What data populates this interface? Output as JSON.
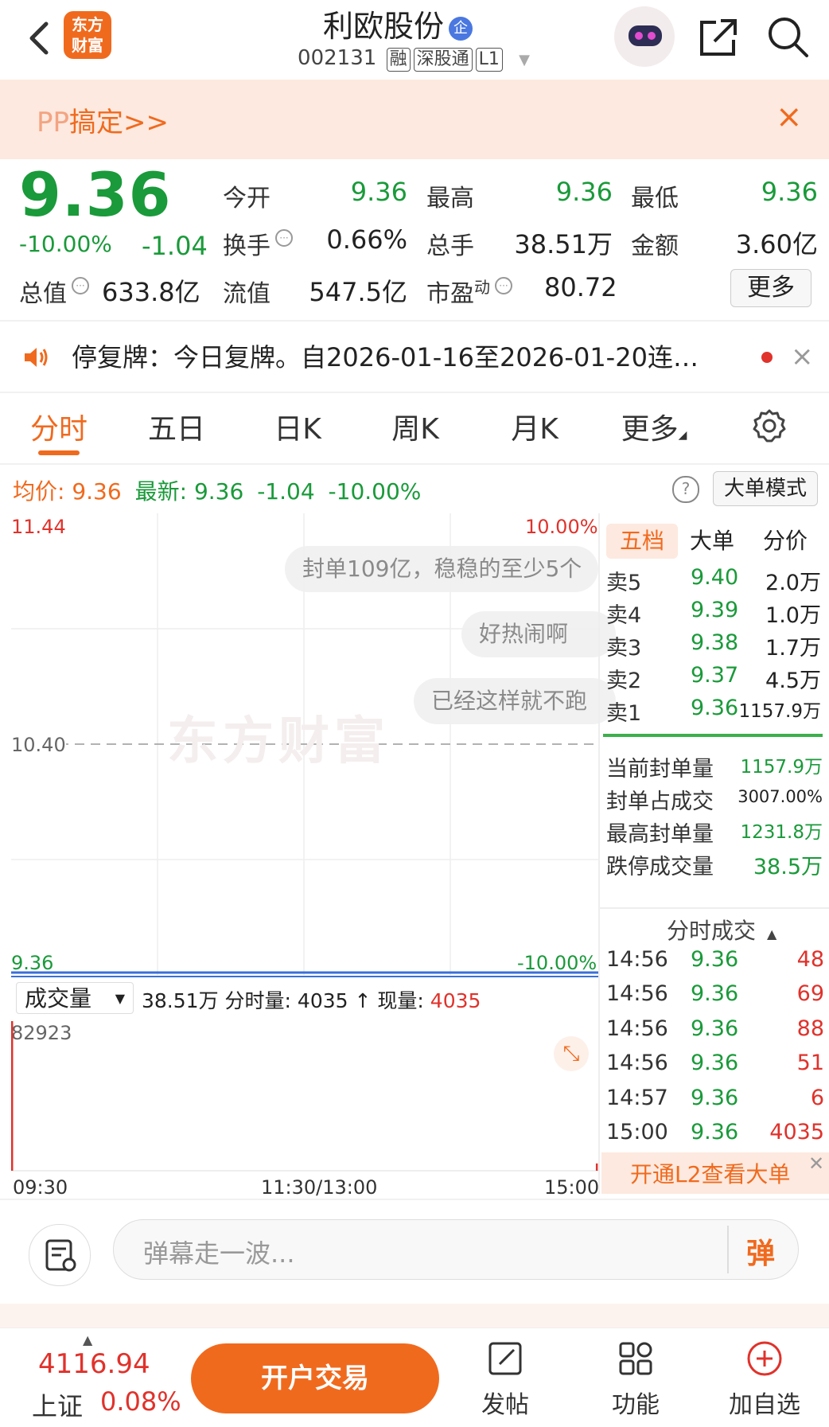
{
  "header": {
    "logo_text_line1": "东方",
    "logo_text_line2": "财富",
    "stock_name": "利欧股份",
    "qi_badge": "企",
    "stock_code": "002131",
    "tags": [
      "融",
      "深股通",
      "L1"
    ]
  },
  "promo": {
    "text_pp": "PP",
    "text_main": "搞定>>",
    "close": "×"
  },
  "quote": {
    "price": "9.36",
    "pct": "-10.00%",
    "change": "-1.04",
    "fields": [
      {
        "label": "今开",
        "value": "9.36",
        "color": "green"
      },
      {
        "label": "最高",
        "value": "9.36",
        "color": "green"
      },
      {
        "label": "最低",
        "value": "9.36",
        "color": "green"
      },
      {
        "label": "换手",
        "value": "0.66%",
        "color": "black"
      },
      {
        "label": "总手",
        "value": "38.51万",
        "color": "black"
      },
      {
        "label": "金额",
        "value": "3.60亿",
        "color": "black"
      },
      {
        "label": "流值",
        "value": "547.5亿",
        "color": "black"
      }
    ],
    "total_value_label": "总值",
    "total_value": "633.8亿",
    "pe_label": "市盈",
    "pe_sup": "动",
    "pe_value": "80.72",
    "more_label": "更多"
  },
  "notice": {
    "text": "停复牌：今日复牌。自2026-01-16至2026-01-20连…",
    "close": "×"
  },
  "tabs": [
    "分时",
    "五日",
    "日K",
    "周K",
    "月K",
    "更多"
  ],
  "info_line": {
    "avg_label": "均价:",
    "avg_value": "9.36",
    "latest_label": "最新:",
    "latest_value": "9.36",
    "change": "-1.04",
    "pct": "-10.00%",
    "help": "?",
    "mode_button": "大单模式"
  },
  "chart": {
    "y_top": "11.44",
    "y_top_pct": "10.00%",
    "y_mid": "10.40",
    "y_bottom": "9.36",
    "y_bottom_pct": "-10.00%",
    "danmu": [
      "封单109亿，稳稳的至少5个",
      "好热闹啊",
      "已经这样就不跑"
    ],
    "watermark": "东方财富",
    "x_labels": [
      "09:30",
      "11:30/13:00",
      "15:00"
    ]
  },
  "chart_data": {
    "type": "line",
    "title": "",
    "ylim": [
      9.36,
      11.44
    ],
    "x": [
      "09:30",
      "11:30/13:00",
      "15:00"
    ],
    "series": [
      {
        "values": [
          9.36,
          9.36,
          9.36
        ]
      }
    ],
    "volume_max": 82923,
    "volume_last": 4035
  },
  "volume": {
    "select_label": "成交量",
    "total": "38.51万",
    "minute_label": "分时量:",
    "minute_value": "4035 ↑",
    "current_label": "现量:",
    "current_value": "4035",
    "max_label": "82923"
  },
  "orderbook": {
    "tabs": [
      "五档",
      "大单",
      "分价"
    ],
    "rows": [
      {
        "label": "卖5",
        "price": "9.40",
        "vol": "2.0万"
      },
      {
        "label": "卖4",
        "price": "9.39",
        "vol": "1.0万"
      },
      {
        "label": "卖3",
        "price": "9.38",
        "vol": "1.7万"
      },
      {
        "label": "卖2",
        "price": "9.37",
        "vol": "4.5万"
      },
      {
        "label": "卖1",
        "price": "9.36",
        "vol": "1157.9万"
      }
    ],
    "stats": [
      {
        "label": "当前封单量",
        "value": "1157.9万"
      },
      {
        "label": "封单占成交",
        "value": "3007.00%"
      },
      {
        "label": "最高封单量",
        "value": "1231.8万"
      },
      {
        "label": "跌停成交量",
        "value": "38.5万"
      }
    ]
  },
  "ticks": {
    "title": "分时成交",
    "rows": [
      {
        "time": "14:56",
        "price": "9.36",
        "vol": "48"
      },
      {
        "time": "14:56",
        "price": "9.36",
        "vol": "69"
      },
      {
        "time": "14:56",
        "price": "9.36",
        "vol": "88"
      },
      {
        "time": "14:56",
        "price": "9.36",
        "vol": "51"
      },
      {
        "time": "14:57",
        "price": "9.36",
        "vol": "6"
      },
      {
        "time": "15:00",
        "price": "9.36",
        "vol": "4035"
      }
    ],
    "open_l2": "开通L2查看大单"
  },
  "danmaku_input": {
    "placeholder": "弹幕走一波...",
    "send": "弹"
  },
  "bottom": {
    "index_value": "4116.94",
    "index_name": "上证",
    "index_pct": "0.08%",
    "trade_button": "开户交易",
    "nav": [
      "发帖",
      "功能",
      "加自选"
    ]
  }
}
